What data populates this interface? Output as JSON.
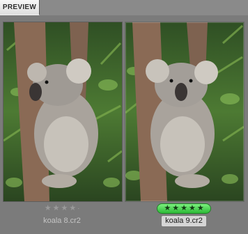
{
  "tabs": [
    {
      "label": "PREVIEW"
    }
  ],
  "photos": [
    {
      "filename": "koala 8.cr2",
      "rating": 0,
      "rating_display": "★★★★·",
      "selected": false
    },
    {
      "filename": "koala 9.cr2",
      "rating": 5,
      "rating_display": "★★★★★",
      "selected": true
    }
  ]
}
